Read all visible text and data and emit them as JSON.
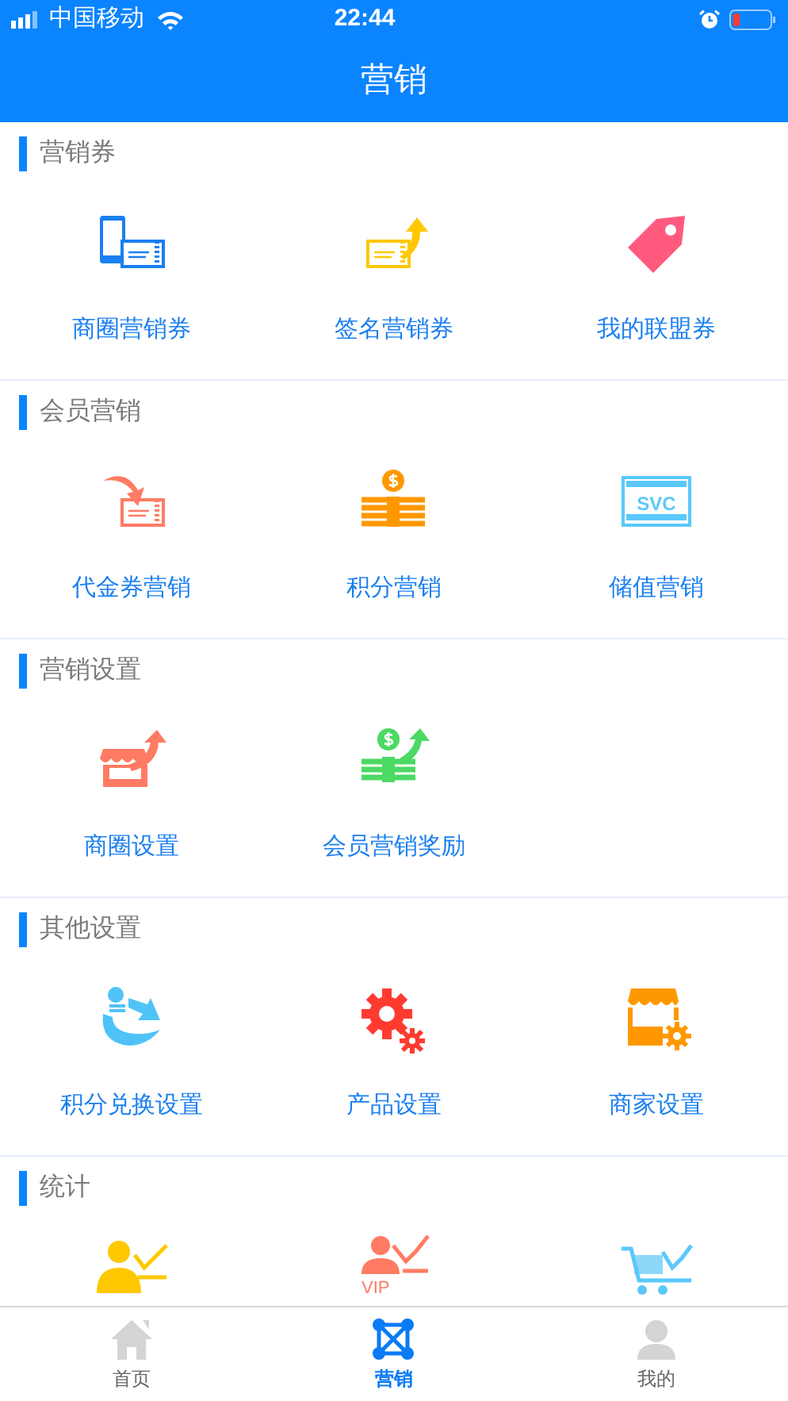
{
  "status_bar": {
    "carrier": "中国移动",
    "time": "22:44"
  },
  "header": {
    "title": "营销"
  },
  "sections": [
    {
      "title": "营销券",
      "items": [
        {
          "label": "商圈营销券"
        },
        {
          "label": "签名营销券"
        },
        {
          "label": "我的联盟券"
        }
      ]
    },
    {
      "title": "会员营销",
      "items": [
        {
          "label": "代金券营销"
        },
        {
          "label": "积分营销"
        },
        {
          "label": "储值营销",
          "icon_text": "SVC"
        }
      ]
    },
    {
      "title": "营销设置",
      "items": [
        {
          "label": "商圈设置"
        },
        {
          "label": "会员营销奖励"
        }
      ]
    },
    {
      "title": "其他设置",
      "items": [
        {
          "label": "积分兑换设置"
        },
        {
          "label": "产品设置"
        },
        {
          "label": "商家设置"
        }
      ]
    },
    {
      "title": "统计",
      "items": [
        {
          "kind": "icon"
        },
        {
          "kind": "icon",
          "icon_text": "VIP"
        },
        {
          "kind": "icon"
        }
      ]
    }
  ],
  "tab_bar": [
    {
      "label": "首页",
      "selected": false
    },
    {
      "label": "营销",
      "selected": true
    },
    {
      "label": "我的",
      "selected": false
    }
  ]
}
